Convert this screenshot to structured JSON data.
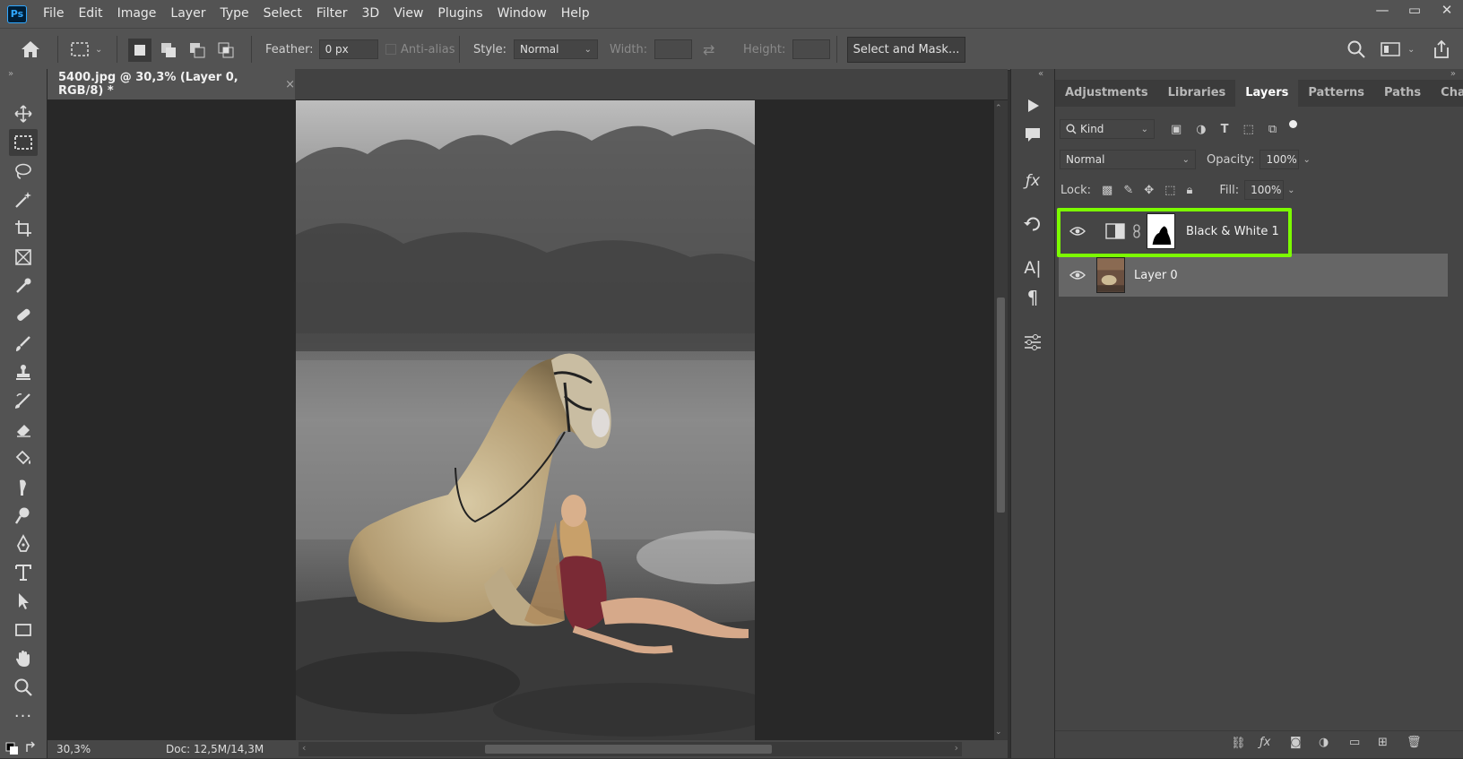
{
  "app": {
    "logo": "Ps"
  },
  "menu": [
    "File",
    "Edit",
    "Image",
    "Layer",
    "Type",
    "Select",
    "Filter",
    "3D",
    "View",
    "Plugins",
    "Window",
    "Help"
  ],
  "window_controls": {
    "minimize": "—",
    "maximize": "▭",
    "close": "✕"
  },
  "options": {
    "feather_label": "Feather:",
    "feather_value": "0 px",
    "antialias_label": "Anti-alias",
    "style_label": "Style:",
    "style_value": "Normal",
    "width_label": "Width:",
    "height_label": "Height:",
    "select_mask_label": "Select and Mask..."
  },
  "document": {
    "tab_title": "5400.jpg @ 30,3% (Layer 0, RGB/8) *",
    "close": "×",
    "zoom": "30,3%",
    "doc_info": "Doc: 12,5M/14,3M"
  },
  "panel": {
    "tabs": [
      "Adjustments",
      "Libraries",
      "Layers",
      "Patterns",
      "Paths",
      "Channels"
    ],
    "active_tab": "Layers",
    "filter_kind": "Kind",
    "blend_mode": "Normal",
    "opacity_label": "Opacity:",
    "opacity_value": "100%",
    "lock_label": "Lock:",
    "fill_label": "Fill:",
    "fill_value": "100%",
    "layers": [
      {
        "name": "Black & White 1",
        "type": "adjustment",
        "visible": true,
        "highlighted": true
      },
      {
        "name": "Layer 0",
        "type": "pixel",
        "visible": true,
        "selected": true
      }
    ]
  },
  "colors": {
    "highlight": "#7cfc00",
    "ui_bg": "#535353",
    "panel_bg": "#454545"
  }
}
